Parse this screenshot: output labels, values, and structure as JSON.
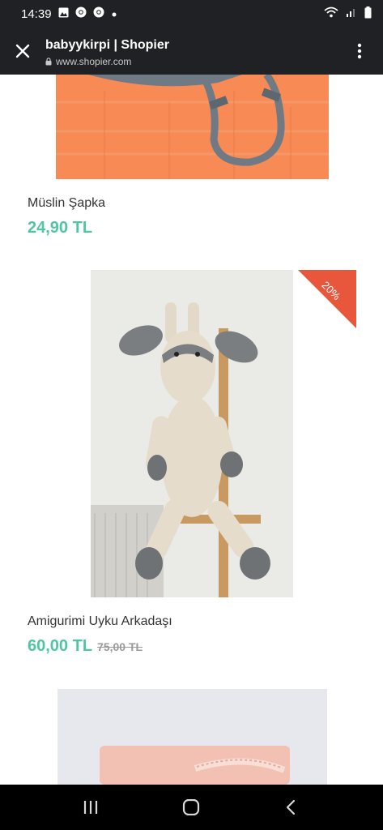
{
  "status_bar": {
    "time": "14:39",
    "icons": [
      "gallery-icon",
      "chrome-icon",
      "chrome-icon",
      "dot-icon",
      "wifi-icon",
      "signal-icon",
      "battery-icon"
    ]
  },
  "browser": {
    "title": "babyykirpi | Shopier",
    "url": "www.shopier.com",
    "icons": [
      "close-icon",
      "lock-icon",
      "more-vert-icon"
    ]
  },
  "products": [
    {
      "name": "Müslin Şapka",
      "price": "24,90 TL"
    },
    {
      "name": "Amigurimi Uyku Arkadaşı",
      "price": "60,00 TL",
      "old_price": "75,00 TL",
      "badge": "20%"
    }
  ],
  "colors": {
    "price": "#4fc6a3",
    "badge": "#e8563b",
    "bars": "#202124"
  },
  "nav_bar": {
    "icons": [
      "recents-icon",
      "home-icon",
      "back-icon"
    ]
  }
}
